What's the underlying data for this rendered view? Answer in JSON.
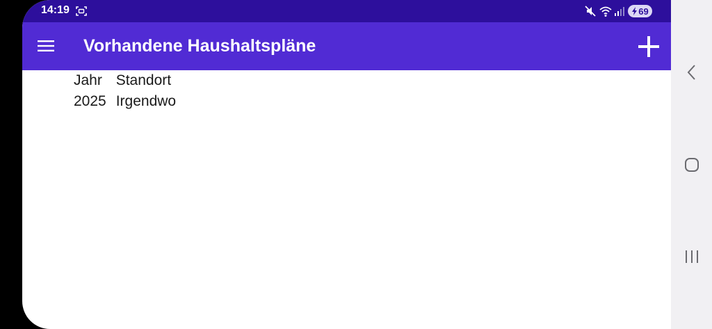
{
  "status_bar": {
    "time": "14:19",
    "battery_level": "69",
    "icons": [
      "screenshot-icon",
      "mute-icon",
      "wifi-icon",
      "signal-icon",
      "charging-icon"
    ]
  },
  "app_bar": {
    "title": "Vorhandene Haushaltspläne",
    "menu_icon": "hamburger-menu-icon",
    "add_icon": "plus-icon",
    "background_color": "#512bd4"
  },
  "table": {
    "columns": [
      "Jahr",
      "Standort"
    ],
    "rows": [
      [
        "2025",
        "Irgendwo"
      ]
    ]
  },
  "nav_bar": {
    "icons": [
      "back-icon",
      "home-icon",
      "recents-icon"
    ]
  },
  "colors": {
    "status_bar": "#2d0f9c",
    "app_bar": "#512bd4",
    "nav_bar": "#f1f0f3"
  }
}
